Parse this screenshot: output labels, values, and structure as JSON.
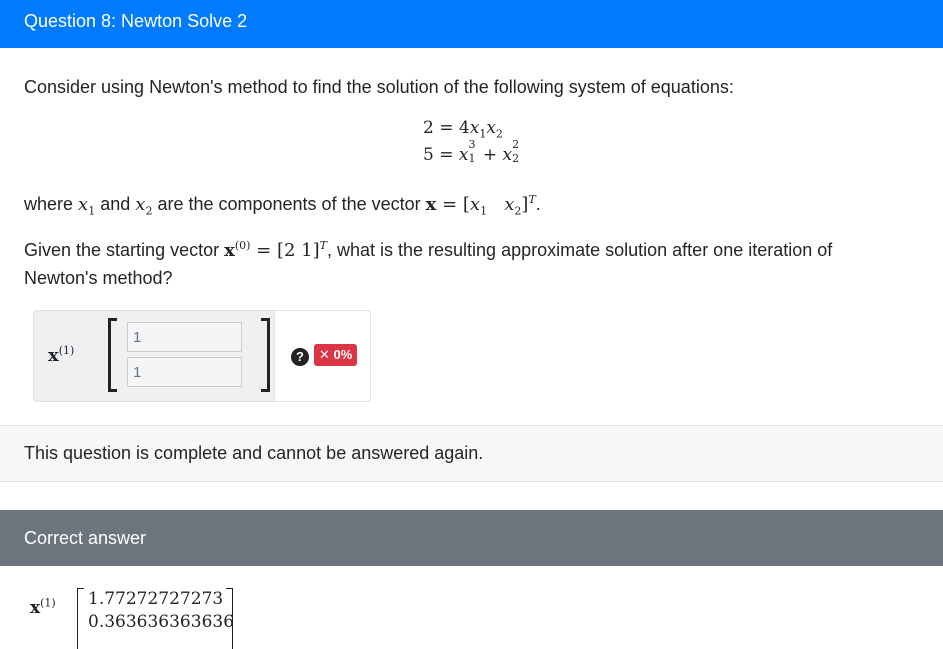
{
  "header": {
    "title": "Question 8: Newton Solve 2"
  },
  "question": {
    "intro": "Consider using Newton's method to find the solution of the following system of equations:",
    "eq1": {
      "lhs": "2",
      "coef": "4",
      "v1": "x",
      "s1": "1",
      "v2": "x",
      "s2": "2"
    },
    "eq2": {
      "lhs": "5",
      "v1": "x",
      "sub1": "1",
      "sup1": "3",
      "v2": "x",
      "sub2": "2",
      "sup2": "2"
    },
    "where_prefix": "where",
    "where_and": "and",
    "where_text": "are the components of the vector",
    "given_prefix": "Given the starting vector",
    "given_vec": "[2   1]",
    "given_text": ", what is the resulting approximate solution after one iteration of",
    "given_line2": "Newton's method?"
  },
  "answer": {
    "label_var": "x",
    "label_sup": "(1)",
    "input1_value": "1",
    "input2_value": "1",
    "help_icon": "?",
    "score_badge": "✕ 0%"
  },
  "status": {
    "complete_text": "This question is complete and cannot be answered again."
  },
  "correct": {
    "header": "Correct answer",
    "label_var": "x",
    "label_sup": "(1)",
    "values": [
      "1.77272727273",
      "0.363636363636"
    ]
  }
}
